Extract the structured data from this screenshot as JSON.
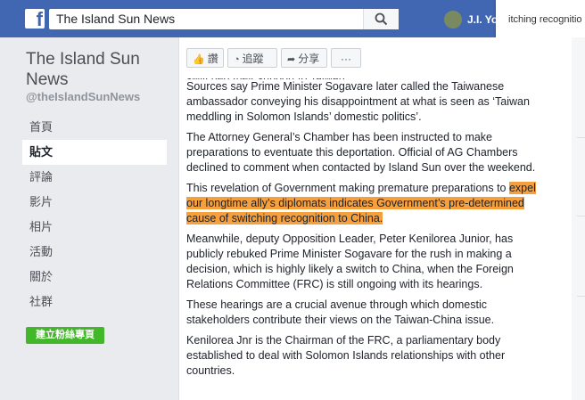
{
  "topbar": {
    "logo": "f",
    "search_value": "The Island Sun News",
    "profile_name": "J.I. Yo",
    "popup_text": "itching recognitio"
  },
  "sidebar": {
    "page_name": "The Island Sun News",
    "handle": "@theIslandSunNews",
    "nav": [
      "首頁",
      "貼文",
      "評論",
      "影片",
      "相片",
      "活動",
      "關於",
      "社群"
    ],
    "active_index": 1,
    "cta_label": "建立粉絲專頁"
  },
  "actions": {
    "like": "讚",
    "follow": "追蹤",
    "share": "分享",
    "more": "···"
  },
  "article": {
    "clipped_line": "switched their support to Taiwan.",
    "p1": "Sources say Prime Minister Sogavare later called the Taiwanese ambassador conveying his disappointment at what is seen as ‘Taiwan meddling in Solomon Islands’ domestic politics’.",
    "p2": "The Attorney General’s Chamber has been instructed to make preparations to eventuate this deportation. Official of AG Chambers declined to comment when contacted by Island Sun over the weekend.",
    "p3_pre": "This revelation of Government making premature preparations to ",
    "p3_highlight": "expel our longtime ally’s diplomats indicates Government’s pre-determined cause of switching recognition to China.",
    "p4": "Meanwhile, deputy Opposition Leader, Peter Kenilorea Junior, has publicly rebuked Prime Minister Sogavare for the rush in making a decision, which is highly likely a switch to China, when the Foreign Relations Committee (FRC) is still ongoing with its hearings.",
    "p5": "These hearings are a crucial avenue through which domestic stakeholders contribute their views on the Taiwan-China issue.",
    "p6": "Kenilorea Jnr is the Chairman of the FRC, a parliamentary body established to deal with Solomon Islands relationships with other countries."
  },
  "colors": {
    "brand": "#4267b2",
    "highlight": "#f5a03d",
    "cta": "#42b72a"
  }
}
